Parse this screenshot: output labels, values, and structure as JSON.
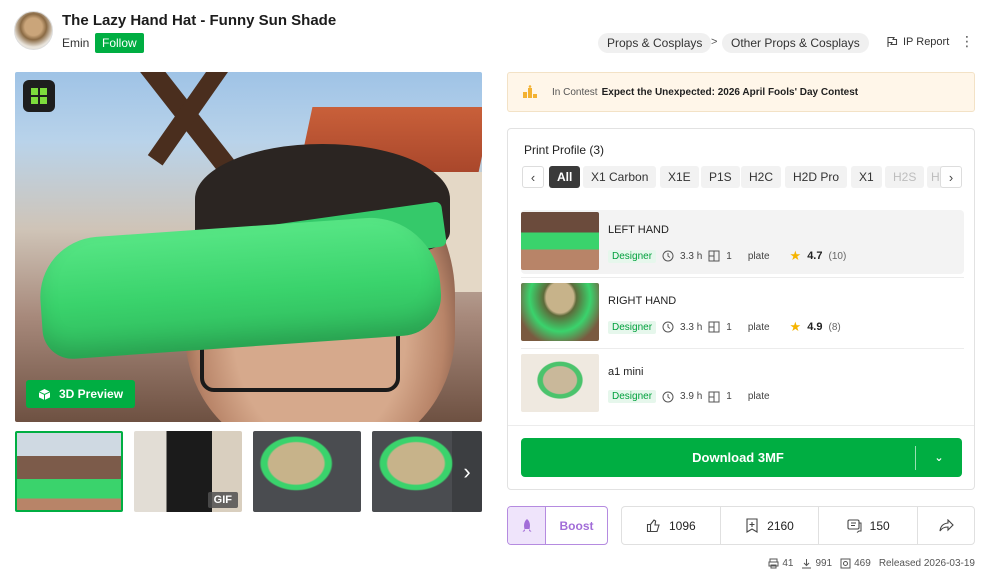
{
  "header": {
    "title": "The Lazy Hand Hat - Funny Sun Shade",
    "author": "Emin",
    "follow_label": "Follow",
    "breadcrumbs": [
      "Props & Cosplays",
      "Other Props & Cosplays"
    ],
    "crumb_separator": ">",
    "ip_report": "IP Report"
  },
  "media": {
    "preview_label": "3D Preview",
    "gif_tag": "GIF"
  },
  "contest": {
    "label": "In Contest",
    "name": "Expect the Unexpected: 2026 April Fools' Day Contest"
  },
  "print_profile": {
    "title": "Print Profile (3)",
    "filters": [
      "All",
      "X1 Carbon",
      "X1E",
      "P1S",
      "H2C",
      "H2D Pro",
      "X1",
      "H2S",
      "H"
    ],
    "profiles": [
      {
        "name": "LEFT HAND",
        "badge": "Designer",
        "time": "3.3 h",
        "plates": "1",
        "plate_label": "plate",
        "rating": "4.7",
        "rating_count": "(10)"
      },
      {
        "name": "RIGHT HAND",
        "badge": "Designer",
        "time": "3.3 h",
        "plates": "1",
        "plate_label": "plate",
        "rating": "4.9",
        "rating_count": "(8)"
      },
      {
        "name": "a1 mini",
        "badge": "Designer",
        "time": "3.9 h",
        "plates": "1",
        "plate_label": "plate"
      }
    ],
    "download_label": "Download 3MF"
  },
  "actions": {
    "boost_label": "Boost",
    "likes": "1096",
    "collections": "2160",
    "comments": "150"
  },
  "footer": {
    "prints": "41",
    "downloads": "991",
    "views": "469",
    "released": "Released 2026-03-19"
  },
  "colors": {
    "accent": "#00ae42",
    "boost": "#a26dd8",
    "contest_bg": "#fff6e9"
  }
}
